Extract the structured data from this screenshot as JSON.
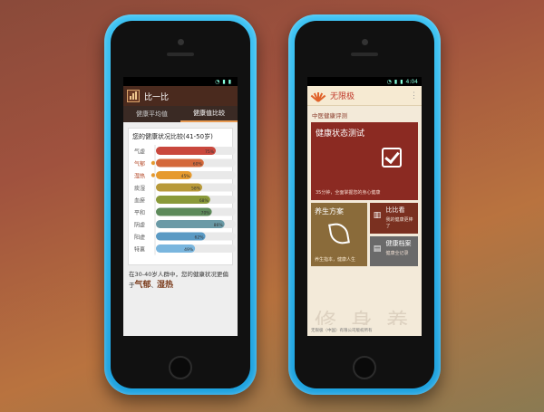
{
  "left_app": {
    "status_time": "",
    "title": "比一比",
    "tabs": [
      {
        "label": "健康平均值",
        "active": false
      },
      {
        "label": "健康值比较",
        "active": true
      }
    ],
    "chart_title": "您的健康状况比较(41-50岁)",
    "description_prefix": "在30-40岁人群中，您的健康状况更偏于",
    "highlight1": "气郁",
    "separator": "、",
    "highlight2": "湿热"
  },
  "chart_data": {
    "type": "bar",
    "categories": [
      "气虚",
      "气郁",
      "湿热",
      "痰湿",
      "血瘀",
      "平和",
      "阴虚",
      "阳虚",
      "特禀"
    ],
    "values": [
      75,
      60,
      45,
      58,
      68,
      70,
      86,
      62,
      49
    ],
    "value_labels": [
      "75%",
      "60%",
      "45%",
      "58%",
      "68%",
      "70%",
      "86%",
      "62%",
      "49%"
    ],
    "colors": [
      "#c9483d",
      "#d4683a",
      "#e69a2e",
      "#b89a3a",
      "#8a9a3a",
      "#5d8a5a",
      "#6a9aa6",
      "#5a9ac4",
      "#7ab6de"
    ],
    "ylim": [
      0,
      100
    ],
    "highlighted": [
      "气郁",
      "湿热"
    ]
  },
  "right_app": {
    "status_time": "4:04",
    "title": "无限极",
    "section": "中医健康评测",
    "main_tile_title": "健康状态测试",
    "main_tile_sub": "35分钟，全面掌握您的身心健康",
    "tile_yang_title": "养生方案",
    "tile_yang_sub": "养生指本，健康人生",
    "tile_bibi_title": "比比看",
    "tile_bibi_sub": "我的健康更棒了",
    "tile_dangan_title": "健康档案",
    "tile_dangan_sub": "健康全记录",
    "footer": "无限极（中国）有限公司版权所有",
    "calligraphy": "修 身 养 性 以 谦"
  },
  "colors": {
    "left_appbar": "#4a2a1e",
    "right_main_tile": "#8b2a22",
    "right_yang_tile": "#8a6b3a"
  }
}
